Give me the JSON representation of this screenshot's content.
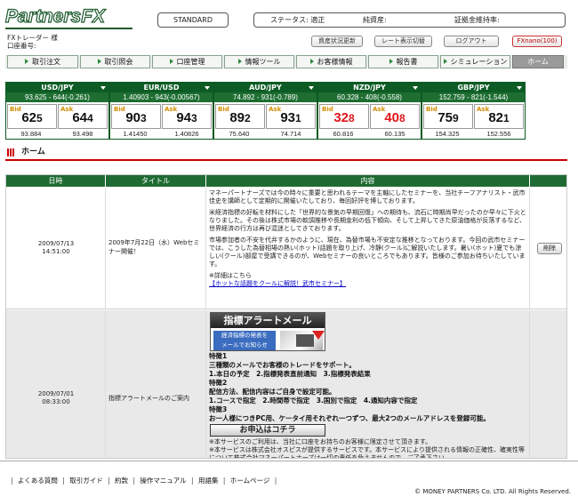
{
  "header": {
    "logo": "PartnersFX",
    "course": "STANDARD",
    "status_label": "ステータス: 適正",
    "net_assets_label": "純資産:",
    "margin_ratio_label": "証拠金維持率:",
    "trader_label": "FXトレーダー 様",
    "account_label": "口座番号:",
    "buttons": {
      "asset_update": "資産状況更新",
      "rate_display": "レート表示切替",
      "logout": "ログアウト",
      "fxnano": "FXnano(100)"
    }
  },
  "nav": [
    "取引注文",
    "取引照会",
    "口座管理",
    "情報ツール",
    "お客様情報",
    "報告書",
    "シミュレーション",
    "ホーム"
  ],
  "rates": [
    {
      "pair": "USD/JPY",
      "sub": "93.625 - 644(-0.261)",
      "bid_main": "62",
      "bid_small": "5",
      "ask_main": "64",
      "ask_small": "4",
      "bid_red": false,
      "ask_red": false,
      "bid_low": "93.884",
      "ask_low": "93.498"
    },
    {
      "pair": "EUR/USD",
      "sub": "1.40903 - 943(-0.00567)",
      "bid_main": "90",
      "bid_small": "3",
      "ask_main": "94",
      "ask_small": "3",
      "bid_red": false,
      "ask_red": false,
      "bid_low": "1.41450",
      "ask_low": "1.40826"
    },
    {
      "pair": "AUD/JPY",
      "sub": "74.892 - 931(-0.789)",
      "bid_main": "89",
      "bid_small": "2",
      "ask_main": "93",
      "ask_small": "1",
      "bid_red": false,
      "ask_red": false,
      "bid_low": "75.640",
      "ask_low": "74.714"
    },
    {
      "pair": "NZD/JPY",
      "sub": "60.328 - 408(-0.558)",
      "bid_main": "32",
      "bid_small": "8",
      "ask_main": "40",
      "ask_small": "8",
      "bid_red": true,
      "ask_red": true,
      "bid_low": "60.816",
      "ask_low": "60.135"
    },
    {
      "pair": "GBP/JPY",
      "sub": "152.759 - 821(-1.544)",
      "bid_main": "75",
      "bid_small": "9",
      "ask_main": "82",
      "ask_small": "1",
      "bid_red": false,
      "ask_red": false,
      "bid_low": "154.325",
      "ask_low": "152.556"
    }
  ],
  "rate_labels": {
    "bid": "Bid",
    "ask": "Ask"
  },
  "section_title": "ホーム",
  "table": {
    "headers": [
      "日時",
      "タイトル",
      "内容"
    ],
    "rows": [
      {
        "date": "2009/07/13",
        "time": "14:51:00",
        "title": "2009年7月22日（水）Webセミナー開催！",
        "body": [
          "マネーパートナーズでは今の時々に重要と思われるテーマを主軸にしたセミナーを、当社チーフアナリスト・武市佳史を講師として定期的に開催いたしており、毎回好評を博しております。",
          "米経済指標の好転を材料にした「世界的な景気の早期回復」への期待も、流石に時期尚早だったのか早々に下火となりました。その後は株式市場の軟調推移や長期金利の低下傾向、そして上昇してきた原油価格が反落するなど、世界経済の行方は再び混迷としてきております。",
          "市場参加者の不安を代弁するかのように、現在、為替市場も不安定な推移となっております。今回の武市セミナーでは、こうした為替相場の熱い(ホット)話題を取り上げ、冷静(クール)に解説いたします。暑い(ホット)夏でも涼しい(クール)部屋で受講できるのが、Webセミナーの良いところでもあります。皆様のご参加お待ちいたしています。",
          "※詳細はこちら"
        ],
        "link": "【ホットな話題をクールに解説！武市セミナー】",
        "delete": "削除"
      },
      {
        "date": "2009/07/01",
        "time": "08:33:00",
        "title": "指標アラートメールのご案内",
        "banner_title": "指標アラートメール",
        "banner_sub1": "経済指標の発表を",
        "banner_sub2": "メールでお知らせ",
        "lines": [
          "特徴1",
          "三種類のメールでお客様のトレードをサポート。",
          "1.本日の予定　2.指標発表直前通知　3.指標発表結果",
          "特徴2",
          "配信方法、配信内容はご自身で設定可能。",
          "1.コースで指定　2.時間帯で指定　3.国別で指定　4.通知内容で指定",
          "特徴3",
          "お一人様につきPC用、ケータイ用それぞれ一つずつ、最大2つのメールアドレスを登録可能。"
        ],
        "apply": "お申込はコチラ",
        "notes": [
          "※本サービスのご利用は、当社に口座をお持ちのお客様に限定させて頂きます。",
          "※本サービスは株式会社オスピスが提供するサービスです。本サービスにより提供される情報の正確性、確実性等について株式会社マネーパートナーズは一切の責任を負えませんので、ご了承下さい。"
        ]
      }
    ]
  },
  "footer": {
    "links": [
      "よくある質問",
      "取引ガイド",
      "約款",
      "操作マニュアル",
      "用語集",
      "ホームページ"
    ],
    "copyright": "© MONEY PARTNERS Co. LTD. All Rights Reserved."
  }
}
